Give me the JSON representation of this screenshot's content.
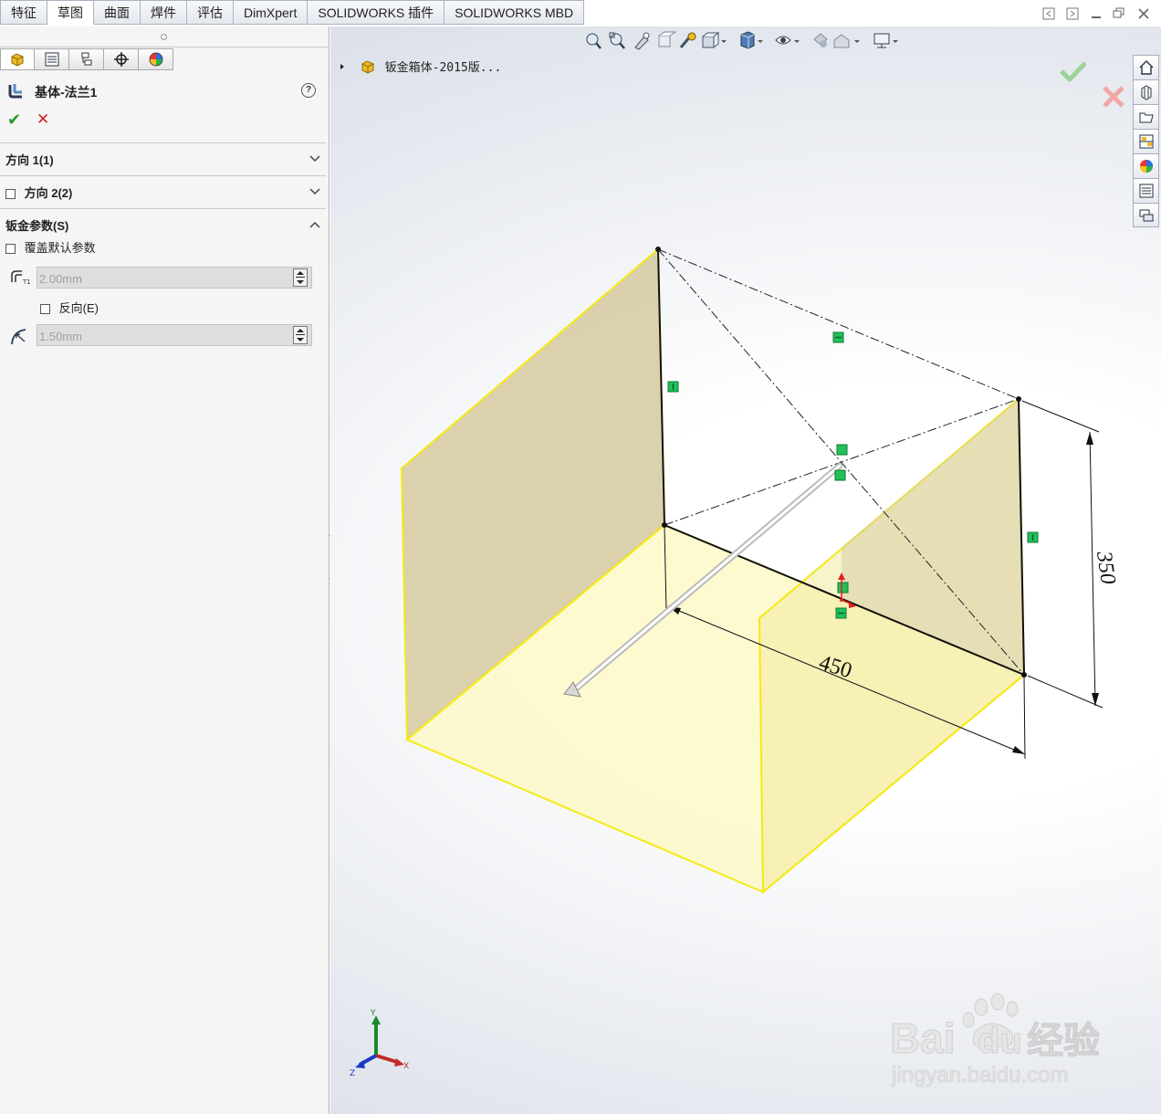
{
  "tabs": [
    "特征",
    "草图",
    "曲面",
    "焊件",
    "评估",
    "DimXpert",
    "SOLIDWORKS 插件",
    "SOLIDWORKS MBD"
  ],
  "active_tab_index": 1,
  "panel": {
    "tab_icons": [
      "feature-manager-icon",
      "property-manager-icon",
      "configuration-manager-icon",
      "dimxpert-manager-icon",
      "display-manager-icon"
    ],
    "feature_title": "基体-法兰1",
    "ok_glyph": "✔",
    "cancel_glyph": "✕",
    "help_glyph": "?",
    "sections": {
      "direction1": {
        "label": "方向 1(1)",
        "chevron": "⌵"
      },
      "direction2": {
        "label": "方向 2(2)",
        "chevron": "⌵"
      },
      "sheetmetal": {
        "label": "钣金参数(S)",
        "chevron": "︿",
        "override_label": "覆盖默认参数",
        "thickness_value": "2.00mm",
        "reverse_label": "反向(E)",
        "radius_value": "1.50mm"
      }
    }
  },
  "tree": {
    "root_label": "钣金箱体-2015版..."
  },
  "dimensions": {
    "height": "350",
    "width": "450"
  },
  "triad": {
    "x": "X",
    "y": "Y",
    "z": "Z"
  },
  "watermark": {
    "brand": "Bai",
    "brand2": "du",
    "cn": "经验",
    "url": "jingyan.baidu.com"
  },
  "colors": {
    "accent_yellow": "#f4ea14",
    "face_tan": "#d8cca4",
    "confirm_green": "#2a9a2a",
    "cancel_red": "#d02020",
    "relation_green": "#22c15a"
  }
}
